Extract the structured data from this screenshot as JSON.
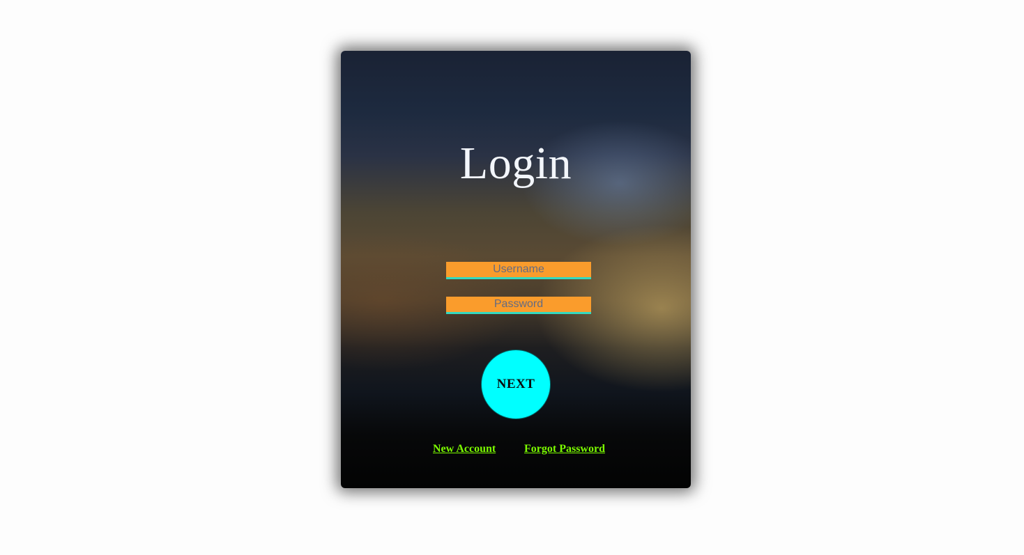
{
  "login": {
    "title": "Login",
    "username_placeholder": "Username",
    "password_placeholder": "Password",
    "next_label": "NEXT",
    "new_account_label": "New Account",
    "forgot_password_label": "Forgot Password"
  },
  "colors": {
    "field_bg": "#fa9c2c",
    "field_underline": "#33d9c0",
    "next_button": "#00ffff",
    "link": "#7cfc00",
    "title": "#f3f6fb",
    "page_bg": "#fdfdfd"
  }
}
